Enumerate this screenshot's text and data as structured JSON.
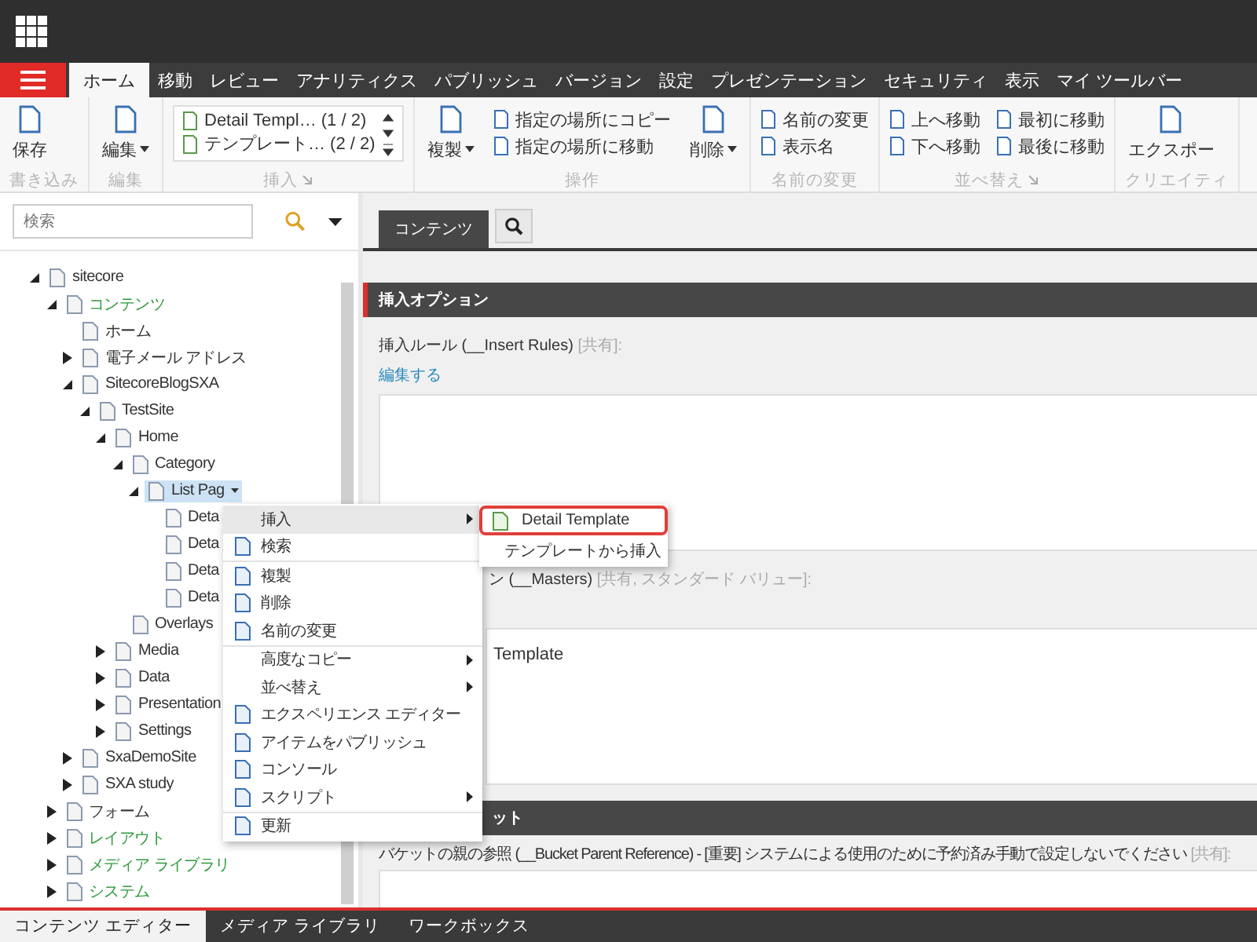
{
  "ribbon": {
    "tabs": [
      {
        "label": "ホーム",
        "selected": true
      },
      {
        "label": "移動",
        "selected": false
      },
      {
        "label": "レビュー",
        "selected": false
      },
      {
        "label": "アナリティクス",
        "selected": false
      },
      {
        "label": "パブリッシュ",
        "selected": false
      },
      {
        "label": "バージョン",
        "selected": false
      },
      {
        "label": "設定",
        "selected": false
      },
      {
        "label": "プレゼンテーション",
        "selected": false
      },
      {
        "label": "セキュリティ",
        "selected": false
      },
      {
        "label": "表示",
        "selected": false
      },
      {
        "label": "マイ ツールバー",
        "selected": false
      }
    ],
    "groups": [
      {
        "label": "書き込み",
        "launcher": false,
        "controls": [
          {
            "kind": "large",
            "label": "保存",
            "dropdown": false
          }
        ]
      },
      {
        "label": "編集",
        "launcher": false,
        "controls": [
          {
            "kind": "large",
            "label": "編集",
            "dropdown": true
          }
        ]
      },
      {
        "label": "挿入",
        "launcher": true,
        "controls": [
          {
            "kind": "gallery",
            "entries": [
              {
                "label": "Detail Templ…",
                "count": "(1 / 2)"
              },
              {
                "label": "テンプレート…",
                "count": "(2 / 2)"
              }
            ]
          }
        ]
      },
      {
        "label": "操作",
        "launcher": false,
        "controls": [
          {
            "kind": "large",
            "label": "複製",
            "dropdown": true
          },
          {
            "kind": "stack",
            "items": [
              "指定の場所にコピー",
              "指定の場所に移動"
            ]
          },
          {
            "kind": "large",
            "label": "削除",
            "dropdown": true
          }
        ]
      },
      {
        "label": "名前の変更",
        "launcher": false,
        "controls": [
          {
            "kind": "stack",
            "items": [
              "名前の変更",
              "表示名"
            ]
          }
        ]
      },
      {
        "label": "並べ替え",
        "launcher": true,
        "controls": [
          {
            "kind": "stack",
            "items": [
              "上へ移動",
              "下へ移動"
            ]
          },
          {
            "kind": "stack",
            "items": [
              "最初に移動",
              "最後に移動"
            ]
          }
        ]
      },
      {
        "label": "クリエイティ",
        "launcher": false,
        "controls": [
          {
            "kind": "large",
            "label": "エクスポー",
            "dropdown": false
          }
        ]
      }
    ]
  },
  "search": {
    "placeholder": "検索"
  },
  "tree": [
    {
      "label": "sitecore",
      "expandable": true,
      "expanded": true,
      "selected": false,
      "color": "#333333",
      "children": [
        {
          "label": "コンテンツ",
          "expandable": true,
          "expanded": true,
          "selected": false,
          "color": "#2e9a3a",
          "children": [
            {
              "label": "ホーム",
              "expandable": false,
              "selected": false,
              "color": "#333333"
            },
            {
              "label": "電子メール アドレス",
              "expandable": true,
              "expanded": false,
              "selected": false,
              "color": "#333333"
            },
            {
              "label": "SitecoreBlogSXA",
              "expandable": true,
              "expanded": true,
              "selected": false,
              "color": "#333333",
              "children": [
                {
                  "label": "TestSite",
                  "expandable": true,
                  "expanded": true,
                  "selected": false,
                  "color": "#333333",
                  "children": [
                    {
                      "label": "Home",
                      "expandable": true,
                      "expanded": true,
                      "selected": false,
                      "color": "#333333",
                      "children": [
                        {
                          "label": "Category",
                          "expandable": true,
                          "expanded": true,
                          "selected": false,
                          "color": "#333333",
                          "children": [
                            {
                              "label": "List Pag",
                              "expandable": true,
                              "expanded": true,
                              "selected": true,
                              "color": "#333333",
                              "children": [
                                {
                                  "label": "Deta",
                                  "expandable": false,
                                  "selected": false,
                                  "color": "#333333"
                                },
                                {
                                  "label": "Deta",
                                  "expandable": false,
                                  "selected": false,
                                  "color": "#333333"
                                },
                                {
                                  "label": "Deta",
                                  "expandable": false,
                                  "selected": false,
                                  "color": "#333333"
                                },
                                {
                                  "label": "Deta",
                                  "expandable": false,
                                  "selected": false,
                                  "color": "#333333"
                                }
                              ]
                            }
                          ]
                        },
                        {
                          "label": "Overlays",
                          "expandable": false,
                          "selected": false,
                          "color": "#333333"
                        }
                      ]
                    },
                    {
                      "label": "Media",
                      "expandable": true,
                      "expanded": false,
                      "selected": false,
                      "color": "#333333"
                    },
                    {
                      "label": "Data",
                      "expandable": true,
                      "expanded": false,
                      "selected": false,
                      "color": "#333333"
                    },
                    {
                      "label": "Presentation",
                      "expandable": true,
                      "expanded": false,
                      "selected": false,
                      "color": "#333333"
                    },
                    {
                      "label": "Settings",
                      "expandable": true,
                      "expanded": false,
                      "selected": false,
                      "color": "#333333"
                    }
                  ]
                }
              ]
            },
            {
              "label": "SxaDemoSite",
              "expandable": true,
              "expanded": false,
              "selected": false,
              "color": "#333333"
            },
            {
              "label": "SXA study",
              "expandable": true,
              "expanded": false,
              "selected": false,
              "color": "#333333"
            }
          ]
        },
        {
          "label": "フォーム",
          "expandable": true,
          "expanded": false,
          "selected": false,
          "color": "#333333"
        },
        {
          "label": "レイアウト",
          "expandable": true,
          "expanded": false,
          "selected": false,
          "color": "#2e9a3a"
        },
        {
          "label": "メディア ライブラリ",
          "expandable": true,
          "expanded": false,
          "selected": false,
          "color": "#2e9a3a"
        },
        {
          "label": "システム",
          "expandable": true,
          "expanded": false,
          "selected": false,
          "color": "#2e9a3a"
        }
      ]
    }
  ],
  "context_menu": {
    "items": [
      {
        "label": "挿入",
        "icon": false,
        "submenu": true,
        "selected": true,
        "divider_before": false
      },
      {
        "label": "検索",
        "icon": true,
        "submenu": false,
        "selected": false,
        "divider_before": false
      },
      {
        "label": "複製",
        "icon": true,
        "submenu": false,
        "selected": false,
        "divider_before": true
      },
      {
        "label": "削除",
        "icon": true,
        "submenu": false,
        "selected": false,
        "divider_before": false
      },
      {
        "label": "名前の変更",
        "icon": true,
        "submenu": false,
        "selected": false,
        "divider_before": false
      },
      {
        "label": "高度なコピー",
        "icon": false,
        "submenu": true,
        "selected": false,
        "divider_before": true
      },
      {
        "label": "並べ替え",
        "icon": false,
        "submenu": true,
        "selected": false,
        "divider_before": false
      },
      {
        "label": "エクスペリエンス エディター",
        "icon": true,
        "submenu": false,
        "selected": false,
        "divider_before": false
      },
      {
        "label": "アイテムをパブリッシュ",
        "icon": true,
        "submenu": false,
        "selected": false,
        "divider_before": false
      },
      {
        "label": "コンソール",
        "icon": true,
        "submenu": false,
        "selected": false,
        "divider_before": false
      },
      {
        "label": "スクリプト",
        "icon": true,
        "submenu": true,
        "selected": false,
        "divider_before": false
      },
      {
        "label": "更新",
        "icon": true,
        "submenu": false,
        "selected": false,
        "divider_before": true
      }
    ]
  },
  "submenu": {
    "items": [
      {
        "label": "Detail Template",
        "selected": true
      },
      {
        "label": "テンプレートから挿入",
        "selected": false
      }
    ]
  },
  "content": {
    "tabs": [
      {
        "label": "コンテンツ",
        "selected": true
      }
    ],
    "sections": [
      {
        "title": "挿入オプション",
        "fields": [
          {
            "label": "挿入ルール (__Insert Rules)",
            "note": "[共有]:",
            "link": "編集する"
          },
          {
            "label": "ン (__Masters)",
            "note": "[共有, スタンダード バリュー]:",
            "value": "Template"
          }
        ]
      },
      {
        "title": "ット",
        "fields": [
          {
            "label": "バケットの親の参照 (__Bucket Parent Reference) - [重要] システムによる使用のために予約済み手動で設定しないでください",
            "note": "[共有]:"
          }
        ]
      }
    ]
  },
  "bottom_tabs": [
    {
      "label": "コンテンツ エディター",
      "selected": true
    },
    {
      "label": "メディア ライブラリ",
      "selected": false
    },
    {
      "label": "ワークボックス",
      "selected": false
    }
  ]
}
